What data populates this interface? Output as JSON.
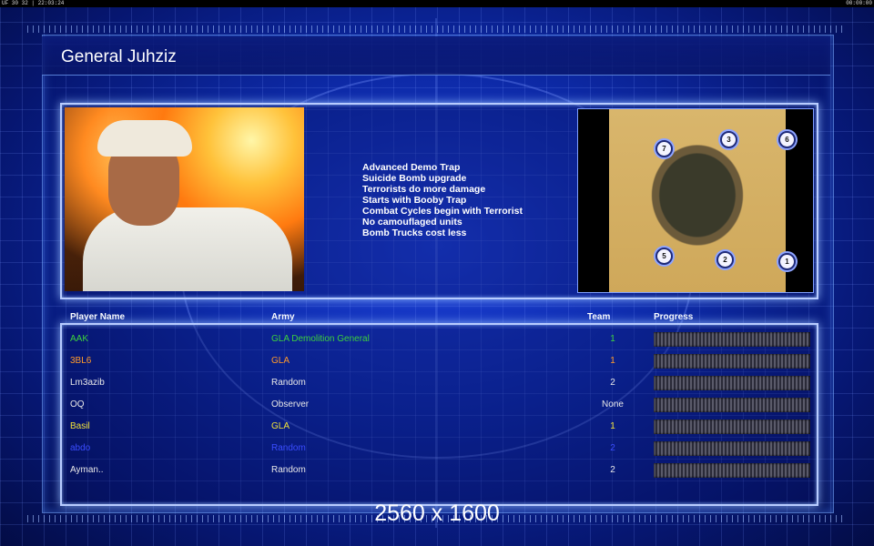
{
  "status_bar": {
    "left": "UF 30 32 | 22:03:24",
    "right": "00:00:00"
  },
  "title": "General Juhziz",
  "traits": [
    "Advanced Demo Trap",
    "Suicide Bomb upgrade",
    "Terrorists do more damage",
    "Starts with Booby Trap",
    "Combat Cycles begin with Terrorist",
    "No camouflaged units",
    "Bomb Trucks cost less"
  ],
  "minimap": {
    "spots": [
      "7",
      "3",
      "6",
      "5",
      "2",
      "1"
    ]
  },
  "columns": {
    "name": "Player Name",
    "army": "Army",
    "team": "Team",
    "progress": "Progress"
  },
  "players": [
    {
      "name": "AAK",
      "army": "GLA Demolition General",
      "team": "1",
      "color": "#3dd23d",
      "progress": 0
    },
    {
      "name": "3BL6",
      "army": "GLA",
      "team": "1",
      "color": "#ff9a2a",
      "progress": 0
    },
    {
      "name": "Lm3azib",
      "army": "Random",
      "team": "2",
      "color": "#e8e8e8",
      "progress": 0
    },
    {
      "name": "OQ",
      "army": "Observer",
      "team": "None",
      "color": "#e8e8e8",
      "progress": 0
    },
    {
      "name": "Basil",
      "army": "GLA",
      "team": "1",
      "color": "#f2e23a",
      "progress": 0
    },
    {
      "name": "abdo",
      "army": "Random",
      "team": "2",
      "color": "#3a4cff",
      "progress": 0
    },
    {
      "name": "Ayman..",
      "army": "Random",
      "team": "2",
      "color": "#e8e8e8",
      "progress": 0
    }
  ],
  "overlay_caption": "2560 x 1600"
}
